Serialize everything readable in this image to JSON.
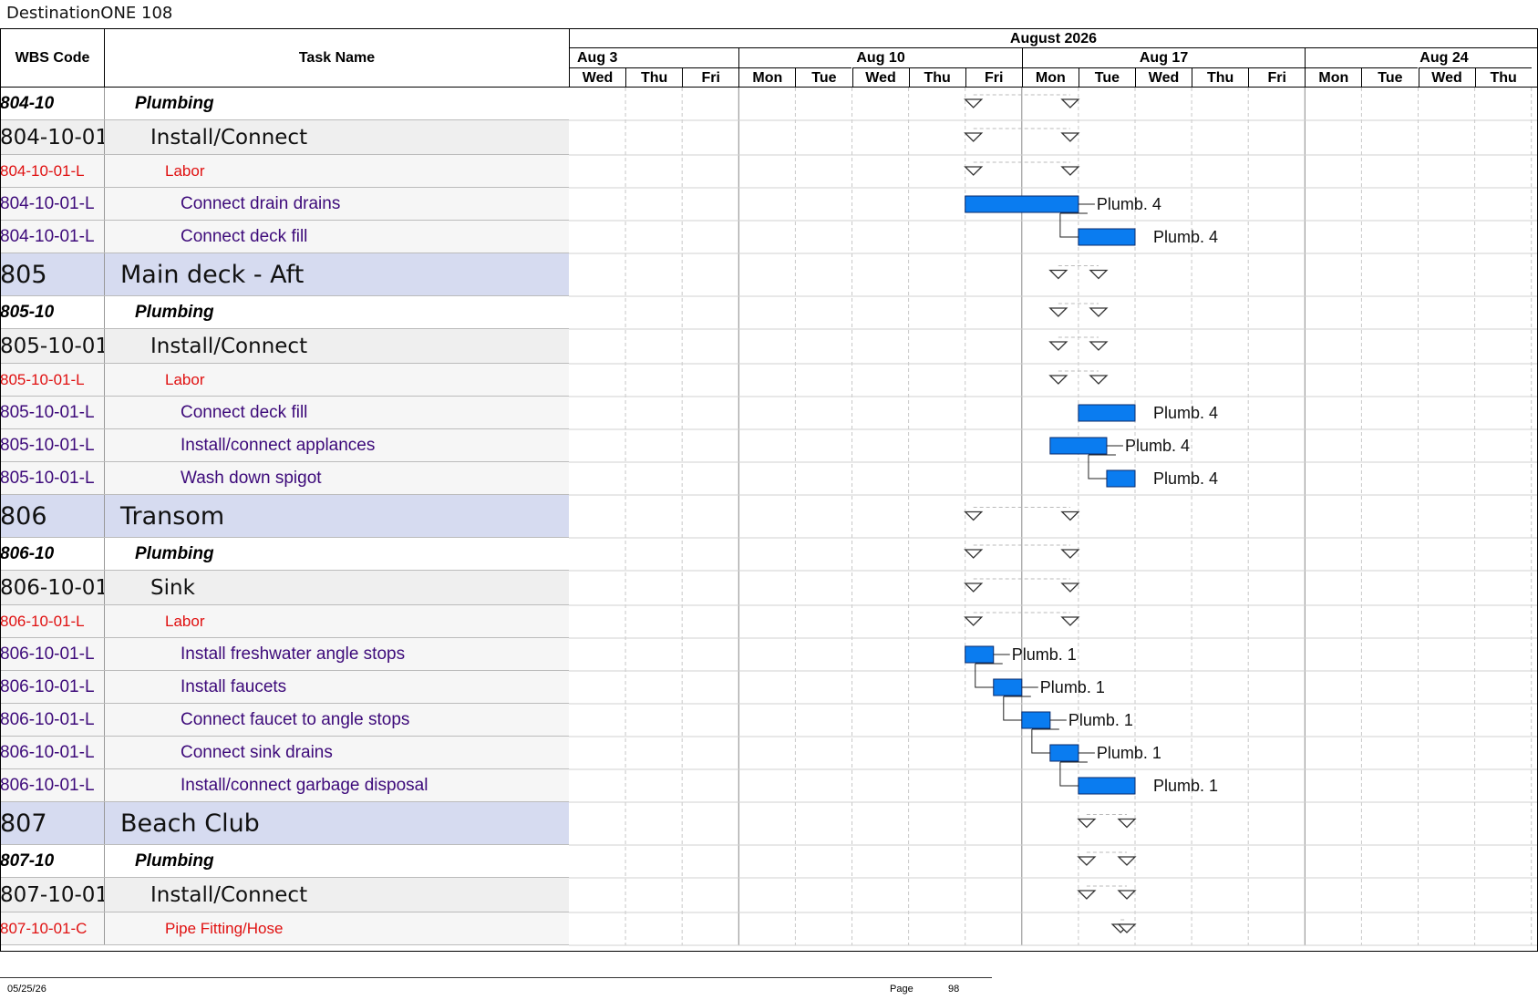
{
  "project_title": "DestinationONE 108",
  "columns": {
    "wbs": "WBS Code",
    "task": "Task Name"
  },
  "timescale": {
    "month": "August 2026",
    "weeks": [
      "Aug 3",
      "Aug 10",
      "Aug 17",
      "Aug 24"
    ],
    "days": [
      "Wed",
      "Thu",
      "Fri",
      "Mon",
      "Tue",
      "Wed",
      "Thu",
      "Fri",
      "Mon",
      "Tue",
      "Wed",
      "Thu",
      "Fri",
      "Mon",
      "Tue",
      "Wed",
      "Thu"
    ]
  },
  "colors": {
    "bar": "#0a7cf0",
    "section_bg": "#d6dbf0",
    "resource_text": "#e01010",
    "activity_text": "#3d0a7a"
  },
  "rows": [
    {
      "level": "grp",
      "wbs": "804-10",
      "task": "Plumbing",
      "summary": [
        7,
        9
      ]
    },
    {
      "level": "sub",
      "wbs": "804-10-01",
      "task": "Install/Connect",
      "summary": [
        7,
        9
      ]
    },
    {
      "level": "res",
      "wbs": "804-10-01-L",
      "task": "Labor",
      "summary": [
        7,
        9
      ]
    },
    {
      "level": "act",
      "wbs": "804-10-01-L",
      "task": "Connect drain drains",
      "bar": [
        7,
        9
      ],
      "resource": "Plumb. 4"
    },
    {
      "level": "act",
      "wbs": "804-10-01-L",
      "task": "Connect deck fill",
      "bar": [
        9,
        10
      ],
      "resource": "Plumb. 4",
      "link_from": 3
    },
    {
      "level": "sec",
      "wbs": "805",
      "task": "Main deck - Aft",
      "summary": [
        8.5,
        9.5
      ]
    },
    {
      "level": "grp",
      "wbs": "805-10",
      "task": "Plumbing",
      "summary": [
        8.5,
        9.5
      ]
    },
    {
      "level": "sub",
      "wbs": "805-10-01",
      "task": "Install/Connect",
      "summary": [
        8.5,
        9.5
      ]
    },
    {
      "level": "res",
      "wbs": "805-10-01-L",
      "task": "Labor",
      "summary": [
        8.5,
        9.5
      ]
    },
    {
      "level": "act",
      "wbs": "805-10-01-L",
      "task": "Connect deck fill",
      "bar": [
        9,
        10
      ],
      "resource": "Plumb. 4"
    },
    {
      "level": "act",
      "wbs": "805-10-01-L",
      "task": "Install/connect applances",
      "bar": [
        8.5,
        9.5
      ],
      "resource": "Plumb. 4"
    },
    {
      "level": "act",
      "wbs": "805-10-01-L",
      "task": "Wash down spigot",
      "bar": [
        9.5,
        10
      ],
      "resource": "Plumb. 4",
      "link_from": 10
    },
    {
      "level": "sec",
      "wbs": "806",
      "task": "Transom",
      "summary": [
        7,
        9
      ]
    },
    {
      "level": "grp",
      "wbs": "806-10",
      "task": "Plumbing",
      "summary": [
        7,
        9
      ]
    },
    {
      "level": "sub",
      "wbs": "806-10-01",
      "task": "Sink",
      "summary": [
        7,
        9
      ]
    },
    {
      "level": "res",
      "wbs": "806-10-01-L",
      "task": "Labor",
      "summary": [
        7,
        9
      ]
    },
    {
      "level": "act",
      "wbs": "806-10-01-L",
      "task": "Install freshwater angle stops",
      "bar": [
        7,
        7.5
      ],
      "resource": "Plumb. 1"
    },
    {
      "level": "act",
      "wbs": "806-10-01-L",
      "task": "Install faucets",
      "bar": [
        7.5,
        8
      ],
      "resource": "Plumb. 1",
      "link_from": 16
    },
    {
      "level": "act",
      "wbs": "806-10-01-L",
      "task": "Connect faucet to angle stops",
      "bar": [
        8,
        8.5
      ],
      "resource": "Plumb. 1",
      "link_from": 17
    },
    {
      "level": "act",
      "wbs": "806-10-01-L",
      "task": "Connect sink drains",
      "bar": [
        8.5,
        9
      ],
      "resource": "Plumb. 1",
      "link_from": 18
    },
    {
      "level": "act",
      "wbs": "806-10-01-L",
      "task": "Install/connect garbage disposal",
      "bar": [
        9,
        10
      ],
      "resource": "Plumb. 1",
      "link_from": 19
    },
    {
      "level": "sec",
      "wbs": "807",
      "task": "Beach Club",
      "summary": [
        9,
        10
      ]
    },
    {
      "level": "grp",
      "wbs": "807-10",
      "task": "Plumbing",
      "summary": [
        9,
        10
      ]
    },
    {
      "level": "sub",
      "wbs": "807-10-01",
      "task": "Install/Connect",
      "summary": [
        9,
        10
      ]
    },
    {
      "level": "res",
      "wbs": "807-10-01-C",
      "task": "Pipe Fitting/Hose",
      "summary": [
        9.6,
        10
      ]
    }
  ],
  "footer": {
    "date": "05/25/26",
    "page_label": "Page",
    "page_number": "98"
  }
}
